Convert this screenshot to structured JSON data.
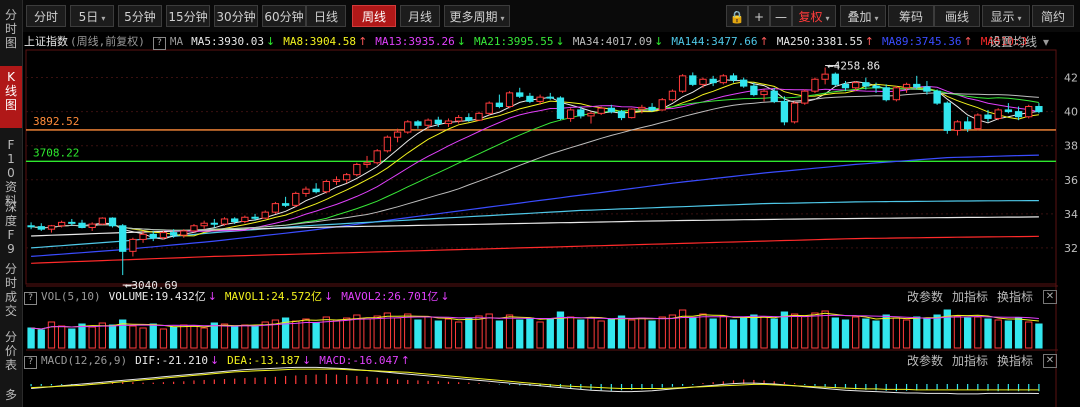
{
  "toolbar": {
    "left_tabs": [
      {
        "label": "分时",
        "active": false,
        "dropdown": false
      },
      {
        "label": "5日",
        "active": false,
        "dropdown": true
      },
      {
        "label": "5分钟",
        "active": false,
        "dropdown": false
      },
      {
        "label": "15分钟",
        "active": false,
        "dropdown": false
      },
      {
        "label": "30分钟",
        "active": false,
        "dropdown": false
      },
      {
        "label": "60分钟",
        "active": false,
        "dropdown": false
      },
      {
        "label": "日线",
        "active": false,
        "dropdown": false
      },
      {
        "label": "周线",
        "active": true,
        "dropdown": false
      },
      {
        "label": "月线",
        "active": false,
        "dropdown": false
      },
      {
        "label": "更多周期",
        "active": false,
        "dropdown": true
      }
    ],
    "tools": [
      {
        "label": "🔒",
        "icon": "lock-icon"
      },
      {
        "label": "+",
        "icon": "zoom-in-icon"
      },
      {
        "label": "—",
        "icon": "zoom-out-icon"
      }
    ],
    "right_tabs": [
      {
        "label": "复权",
        "dropdown": true,
        "red": true
      },
      {
        "label": "叠加",
        "dropdown": true,
        "red": false
      },
      {
        "label": "筹码",
        "dropdown": false,
        "red": false
      },
      {
        "label": "画线",
        "dropdown": false,
        "red": false
      },
      {
        "label": "显示",
        "dropdown": true,
        "red": false
      },
      {
        "label": "简约",
        "dropdown": false,
        "red": false
      }
    ]
  },
  "sidebar": [
    {
      "label": "分时图",
      "active": false
    },
    {
      "label": "K线图",
      "active": true
    },
    {
      "label": "F10资料",
      "active": false
    },
    {
      "label": "深度F9",
      "active": false
    },
    {
      "label": "分时成交",
      "active": false
    },
    {
      "label": "分价表",
      "active": false
    },
    {
      "label": "多",
      "active": false
    }
  ],
  "ma_bar": {
    "name": "上证指数",
    "subtitle": "(周线,前复权)",
    "ma_label": "MA",
    "items": [
      {
        "text": "MA5:3930.03",
        "arrow": "↓",
        "color": "#e8e8e8"
      },
      {
        "text": "MA8:3904.58",
        "arrow": "↑",
        "color": "#f2f21e"
      },
      {
        "text": "MA13:3935.26",
        "arrow": "↓",
        "color": "#e040fb"
      },
      {
        "text": "MA21:3995.55",
        "arrow": "↓",
        "color": "#38e838"
      },
      {
        "text": "MA34:4017.09",
        "arrow": "↓",
        "color": "#bdbdbd"
      },
      {
        "text": "MA144:3477.66",
        "arrow": "↑",
        "color": "#4fc8e8"
      },
      {
        "text": "MA250:3381.55",
        "arrow": "↑",
        "color": "#e8e8e8"
      },
      {
        "text": "MA89:3745.36",
        "arrow": "↑",
        "color": "#3a4cff"
      },
      {
        "text": "MA610:3",
        "arrow": "",
        "color": "#ff2a2a"
      }
    ],
    "settings_label": "设置均线"
  },
  "vol_bar": {
    "label": "VOL(5,10)",
    "items": [
      {
        "text": "VOLUME:19.432亿",
        "arrow": "↓",
        "color": "#e8e8e8"
      },
      {
        "text": "MAVOL1:24.572亿",
        "arrow": "↓",
        "color": "#f2f21e"
      },
      {
        "text": "MAVOL2:26.701亿",
        "arrow": "↓",
        "color": "#e040fb"
      }
    ],
    "buttons": [
      "改参数",
      "加指标",
      "换指标"
    ]
  },
  "macd_bar": {
    "label": "MACD(12,26,9)",
    "items": [
      {
        "text": "DIF:-21.210",
        "arrow": "↓",
        "color": "#e8e8e8"
      },
      {
        "text": "DEA:-13.187",
        "arrow": "↓",
        "color": "#f2f21e"
      },
      {
        "text": "MACD:-16.047",
        "arrow": "↑",
        "color": "#e040fb"
      }
    ],
    "buttons": [
      "改参数",
      "加指标",
      "换指标"
    ]
  },
  "colors": {
    "up": "#ff3b3b",
    "down": "#33e6ee",
    "grid": "#3a1010",
    "orange_line": "#ff8c3a",
    "green_line": "#2ee82e"
  },
  "chart_data": {
    "type": "candlestick",
    "ylim": [
      3000,
      4350
    ],
    "y_ticks": [
      4200,
      4000,
      3800,
      3600,
      3400,
      3200
    ],
    "y_tick_labels": [
      "42",
      "40",
      "38",
      "36",
      "34",
      "32"
    ],
    "h_lines": [
      {
        "value": 3892.52,
        "label": "3892.52",
        "color": "#ff8c3a"
      },
      {
        "value": 3708.22,
        "label": "3708.22",
        "color": "#2ee82e"
      }
    ],
    "annotations": [
      {
        "label": "4258.86",
        "index": 78,
        "value": 4258.86,
        "kind": "high"
      },
      {
        "label": "3040.69",
        "index": 9,
        "value": 3040.69,
        "kind": "low"
      }
    ],
    "candles": [
      [
        3330,
        3350,
        3310,
        3325
      ],
      [
        3325,
        3345,
        3300,
        3310
      ],
      [
        3310,
        3335,
        3290,
        3330
      ],
      [
        3330,
        3360,
        3320,
        3350
      ],
      [
        3350,
        3370,
        3330,
        3345
      ],
      [
        3345,
        3365,
        3315,
        3320
      ],
      [
        3320,
        3350,
        3300,
        3340
      ],
      [
        3340,
        3380,
        3335,
        3375
      ],
      [
        3375,
        3380,
        3320,
        3330
      ],
      [
        3330,
        3340,
        3040.69,
        3180
      ],
      [
        3180,
        3260,
        3150,
        3250
      ],
      [
        3250,
        3300,
        3230,
        3280
      ],
      [
        3280,
        3300,
        3240,
        3260
      ],
      [
        3260,
        3300,
        3250,
        3290
      ],
      [
        3290,
        3310,
        3260,
        3275
      ],
      [
        3275,
        3310,
        3260,
        3300
      ],
      [
        3300,
        3340,
        3290,
        3330
      ],
      [
        3330,
        3360,
        3310,
        3345
      ],
      [
        3345,
        3370,
        3320,
        3340
      ],
      [
        3340,
        3380,
        3330,
        3370
      ],
      [
        3370,
        3380,
        3340,
        3355
      ],
      [
        3355,
        3390,
        3345,
        3380
      ],
      [
        3380,
        3400,
        3360,
        3375
      ],
      [
        3375,
        3420,
        3370,
        3410
      ],
      [
        3410,
        3470,
        3400,
        3460
      ],
      [
        3460,
        3500,
        3440,
        3450
      ],
      [
        3450,
        3530,
        3440,
        3520
      ],
      [
        3520,
        3560,
        3500,
        3545
      ],
      [
        3545,
        3580,
        3520,
        3530
      ],
      [
        3530,
        3600,
        3520,
        3590
      ],
      [
        3590,
        3620,
        3570,
        3600
      ],
      [
        3600,
        3640,
        3580,
        3630
      ],
      [
        3630,
        3700,
        3620,
        3690
      ],
      [
        3690,
        3740,
        3670,
        3700
      ],
      [
        3700,
        3780,
        3690,
        3770
      ],
      [
        3770,
        3860,
        3760,
        3850
      ],
      [
        3850,
        3900,
        3820,
        3880
      ],
      [
        3880,
        3950,
        3870,
        3940
      ],
      [
        3940,
        3950,
        3900,
        3920
      ],
      [
        3920,
        3960,
        3900,
        3950
      ],
      [
        3950,
        3970,
        3910,
        3930
      ],
      [
        3930,
        3960,
        3910,
        3945
      ],
      [
        3945,
        3980,
        3930,
        3965
      ],
      [
        3965,
        3990,
        3940,
        3950
      ],
      [
        3950,
        4000,
        3945,
        3990
      ],
      [
        3990,
        4060,
        3980,
        4050
      ],
      [
        4050,
        4100,
        4020,
        4030
      ],
      [
        4030,
        4120,
        4020,
        4110
      ],
      [
        4110,
        4140,
        4080,
        4090
      ],
      [
        4090,
        4110,
        4050,
        4060
      ],
      [
        4060,
        4100,
        4040,
        4085
      ],
      [
        4085,
        4110,
        4070,
        4080
      ],
      [
        4080,
        4090,
        3950,
        3960
      ],
      [
        3960,
        4020,
        3940,
        4010
      ],
      [
        4010,
        4030,
        3960,
        3975
      ],
      [
        3975,
        4000,
        3930,
        3990
      ],
      [
        3990,
        4030,
        3980,
        4020
      ],
      [
        4020,
        4040,
        3990,
        4000
      ],
      [
        4000,
        4010,
        3950,
        3965
      ],
      [
        3965,
        4020,
        3960,
        4015
      ],
      [
        4015,
        4040,
        3990,
        4025
      ],
      [
        4025,
        4050,
        4000,
        4010
      ],
      [
        4010,
        4080,
        4005,
        4070
      ],
      [
        4070,
        4130,
        4060,
        4120
      ],
      [
        4120,
        4220,
        4110,
        4210
      ],
      [
        4210,
        4230,
        4150,
        4160
      ],
      [
        4160,
        4200,
        4140,
        4190
      ],
      [
        4190,
        4210,
        4150,
        4170
      ],
      [
        4170,
        4220,
        4160,
        4210
      ],
      [
        4210,
        4225,
        4170,
        4185
      ],
      [
        4185,
        4200,
        4140,
        4150
      ],
      [
        4150,
        4170,
        4090,
        4100
      ],
      [
        4100,
        4130,
        4060,
        4120
      ],
      [
        4120,
        4140,
        4050,
        4060
      ],
      [
        4060,
        4090,
        3920,
        3940
      ],
      [
        3940,
        4060,
        3930,
        4050
      ],
      [
        4050,
        4130,
        4040,
        4120
      ],
      [
        4120,
        4200,
        4110,
        4190
      ],
      [
        4190,
        4258.86,
        4160,
        4220
      ],
      [
        4220,
        4230,
        4150,
        4160
      ],
      [
        4160,
        4180,
        4120,
        4140
      ],
      [
        4140,
        4180,
        4120,
        4170
      ],
      [
        4170,
        4200,
        4130,
        4150
      ],
      [
        4150,
        4170,
        4110,
        4140
      ],
      [
        4140,
        4160,
        4060,
        4070
      ],
      [
        4070,
        4150,
        4060,
        4140
      ],
      [
        4140,
        4170,
        4110,
        4160
      ],
      [
        4160,
        4210,
        4130,
        4145
      ],
      [
        4145,
        4180,
        4100,
        4120
      ],
      [
        4120,
        4130,
        4040,
        4050
      ],
      [
        4050,
        4060,
        3870,
        3890
      ],
      [
        3890,
        3950,
        3860,
        3940
      ],
      [
        3940,
        3970,
        3880,
        3900
      ],
      [
        3900,
        3990,
        3890,
        3980
      ],
      [
        3980,
        4010,
        3940,
        3960
      ],
      [
        3960,
        4020,
        3950,
        4010
      ],
      [
        4010,
        4050,
        3990,
        4000
      ],
      [
        4000,
        4030,
        3950,
        3970
      ],
      [
        3970,
        4040,
        3960,
        4030
      ],
      [
        4030,
        4050,
        3990,
        4000
      ]
    ],
    "ma_lines": [
      {
        "name": "MA5",
        "color": "#e8e8e8",
        "window": 5
      },
      {
        "name": "MA8",
        "color": "#f2f21e",
        "window": 8
      },
      {
        "name": "MA13",
        "color": "#e040fb",
        "window": 13
      },
      {
        "name": "MA21",
        "color": "#38e838",
        "window": 21
      },
      {
        "name": "MA34",
        "color": "#bdbdbd",
        "window": 34
      },
      {
        "name": "MA89",
        "color": "#3a4cff",
        "points": [
          3150,
          3190,
          3240,
          3300,
          3370,
          3440,
          3510,
          3580,
          3640,
          3690,
          3730,
          3745
        ]
      },
      {
        "name": "MA144",
        "color": "#4fc8e8",
        "points": [
          3200,
          3240,
          3290,
          3330,
          3360,
          3390,
          3420,
          3440,
          3460,
          3470,
          3475,
          3478
        ]
      },
      {
        "name": "MA250",
        "color": "#e8e8e8",
        "points": [
          3270,
          3290,
          3305,
          3320,
          3330,
          3340,
          3350,
          3360,
          3367,
          3373,
          3378,
          3382
        ]
      },
      {
        "name": "MA610",
        "color": "#ff2a2a",
        "points": [
          3110,
          3130,
          3150,
          3165,
          3180,
          3195,
          3210,
          3225,
          3240,
          3255,
          3262,
          3268
        ]
      }
    ],
    "volume": {
      "unit": "亿",
      "bars": [
        20,
        18,
        26,
        22,
        19,
        24,
        21,
        25,
        23,
        28,
        22,
        20,
        24,
        19,
        21,
        23,
        22,
        20,
        25,
        24,
        21,
        23,
        22,
        26,
        28,
        30,
        27,
        29,
        25,
        31,
        28,
        30,
        33,
        29,
        32,
        35,
        30,
        34,
        28,
        31,
        27,
        29,
        26,
        30,
        32,
        34,
        27,
        33,
        28,
        30,
        26,
        29,
        36,
        31,
        28,
        30,
        27,
        29,
        32,
        28,
        30,
        27,
        31,
        33,
        38,
        30,
        34,
        29,
        32,
        28,
        30,
        33,
        31,
        29,
        36,
        34,
        32,
        35,
        37,
        30,
        28,
        31,
        29,
        27,
        33,
        30,
        28,
        31,
        29,
        33,
        38,
        32,
        30,
        31,
        29,
        28,
        27,
        30,
        26,
        24
      ]
    },
    "macd": {
      "hist": [
        -5,
        -4,
        -3,
        -2,
        -1,
        1,
        2,
        3,
        4,
        5,
        4,
        3,
        3,
        4,
        5,
        6,
        8,
        9,
        10,
        11,
        12,
        13,
        14,
        15,
        16,
        18,
        19,
        20,
        21,
        22,
        21,
        20,
        18,
        16,
        14,
        12,
        10,
        9,
        8,
        7,
        6,
        5,
        4,
        3,
        2,
        1,
        -1,
        -2,
        -3,
        -4,
        -5,
        -6,
        -8,
        -10,
        -12,
        -13,
        -14,
        -15,
        -14,
        -13,
        -12,
        -10,
        -8,
        -6,
        -4,
        -2,
        2,
        4,
        6,
        8,
        10,
        9,
        8,
        6,
        4,
        2,
        -2,
        -4,
        -6,
        -8,
        -10,
        -12,
        -13,
        -14,
        -15,
        -16,
        -15,
        -14,
        -13,
        -12,
        -11,
        -12,
        -13,
        -14,
        -15,
        -16,
        -15,
        -16,
        -16,
        -16
      ],
      "dif": [
        -10,
        -8,
        -6,
        -4,
        -2,
        0,
        2,
        4,
        6,
        8,
        10,
        12,
        14,
        16,
        18,
        20,
        22,
        24,
        26,
        28,
        30,
        32,
        33,
        34,
        35,
        36,
        37,
        37,
        37,
        36,
        35,
        34,
        32,
        30,
        28,
        26,
        24,
        22,
        20,
        18,
        16,
        14,
        12,
        10,
        8,
        6,
        4,
        2,
        0,
        -2,
        -4,
        -6,
        -8,
        -10,
        -12,
        -14,
        -15,
        -16,
        -17,
        -17,
        -16,
        -15,
        -13,
        -11,
        -9,
        -7,
        -5,
        -3,
        -1,
        1,
        2,
        2,
        1,
        0,
        -2,
        -4,
        -6,
        -8,
        -10,
        -12,
        -14,
        -15,
        -16,
        -17,
        -18,
        -19,
        -20,
        -20,
        -21,
        -21,
        -21,
        -22,
        -22,
        -22,
        -21,
        -21,
        -21,
        -21,
        -21,
        -21.21
      ],
      "dea": [
        -8,
        -7,
        -6,
        -5,
        -4,
        -3,
        -1,
        1,
        3,
        5,
        7,
        9,
        11,
        13,
        15,
        17,
        19,
        21,
        23,
        25,
        27,
        28,
        29,
        30,
        31,
        32,
        33,
        33,
        33,
        33,
        33,
        32,
        31,
        30,
        29,
        28,
        27,
        26,
        24,
        22,
        20,
        18,
        16,
        14,
        12,
        10,
        8,
        6,
        4,
        2,
        0,
        -2,
        -4,
        -5,
        -6,
        -7,
        -8,
        -9,
        -10,
        -10,
        -10,
        -10,
        -10,
        -9,
        -8,
        -7,
        -6,
        -5,
        -4,
        -3,
        -2,
        -1,
        -1,
        -2,
        -3,
        -4,
        -5,
        -6,
        -7,
        -8,
        -9,
        -10,
        -11,
        -11,
        -12,
        -12,
        -12,
        -13,
        -13,
        -13,
        -13,
        -13,
        -13,
        -13,
        -13,
        -13,
        -13,
        -13,
        -13,
        -13.187
      ]
    }
  }
}
